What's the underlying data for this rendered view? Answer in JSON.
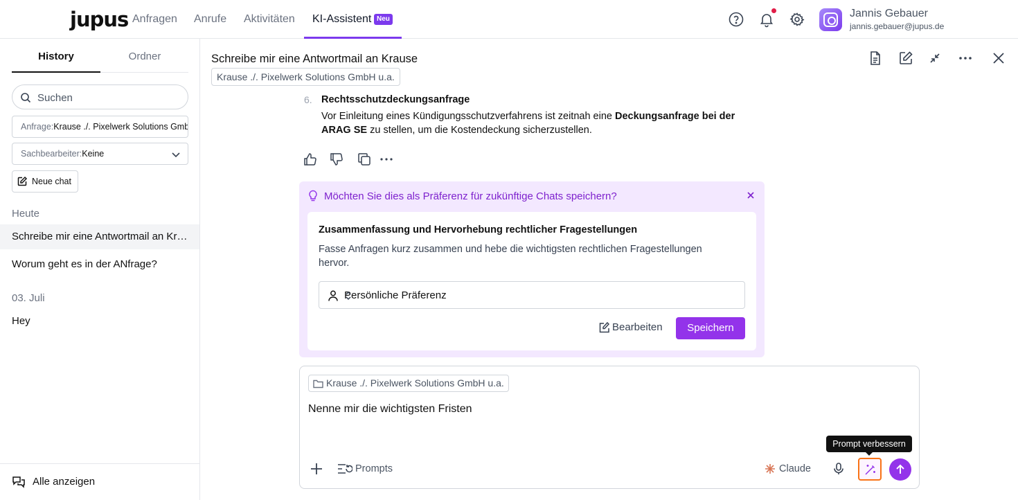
{
  "app": {
    "logo": "jupus"
  },
  "nav": {
    "items": [
      {
        "label": "Anfragen"
      },
      {
        "label": "Anrufe"
      },
      {
        "label": "Aktivitäten"
      },
      {
        "label": "KI-Assistent"
      }
    ],
    "active_badge": "Neu"
  },
  "user": {
    "name": "Jannis Gebauer",
    "email": "jannis.gebauer@jupus.de"
  },
  "sidebar": {
    "tabs": [
      {
        "label": "History"
      },
      {
        "label": "Ordner"
      }
    ],
    "search_placeholder": "Suchen",
    "filter_inquiry": {
      "label": "Anfrage:",
      "value": "Krause ./. Pixelwerk Solutions GmbH u.a."
    },
    "filter_agent": {
      "label": "Sachbearbeiter:",
      "value": "Keine"
    },
    "new_chat": "Neue chat",
    "groups": [
      {
        "title": "Heute",
        "items": [
          "Schreibe mir eine Antwortmail an Krause",
          "Worum geht es in der ANfrage?"
        ]
      },
      {
        "title": "03. Juli",
        "items": [
          "Hey"
        ]
      }
    ],
    "footer": "Alle anzeigen"
  },
  "chat": {
    "title": "Schreibe mir eine Antwortmail an Krause",
    "case_chip": "Krause ./. Pixelwerk Solutions GmbH u.a.",
    "list_item": {
      "number": "6.",
      "heading": "Rechtsschutzdeckungsanfrage",
      "body_pre": "Vor Einleitung eines Kündigungsschutzverfahrens ist zeitnah eine ",
      "body_bold": "Deckungsanfrage bei der ARAG SE",
      "body_post": " zu stellen, um die Kostendeckung sicherzustellen."
    }
  },
  "preference": {
    "question": "Möchten Sie dies als Präferenz für zukünftige Chats speichern?",
    "title": "Zusammenfassung und Hervorhebung rechtlicher Fragestellungen",
    "description": "Fasse Anfragen kurz zusammen und hebe die wichtigsten rechtlichen Fragestellungen hervor.",
    "scope": "Persönliche Präferenz",
    "edit_label": "Bearbeiten",
    "save_label": "Speichern"
  },
  "composer": {
    "chip": "Krause ./. Pixelwerk Solutions GmbH u.a.",
    "text": "Nenne mir die wichtigsten Fristen",
    "prompts_label": "Prompts",
    "model": "Claude",
    "tooltip": "Prompt verbessern"
  },
  "colors": {
    "accent": "#9333ea",
    "pref_bg": "#f3e8ff",
    "highlight": "#f97316"
  }
}
